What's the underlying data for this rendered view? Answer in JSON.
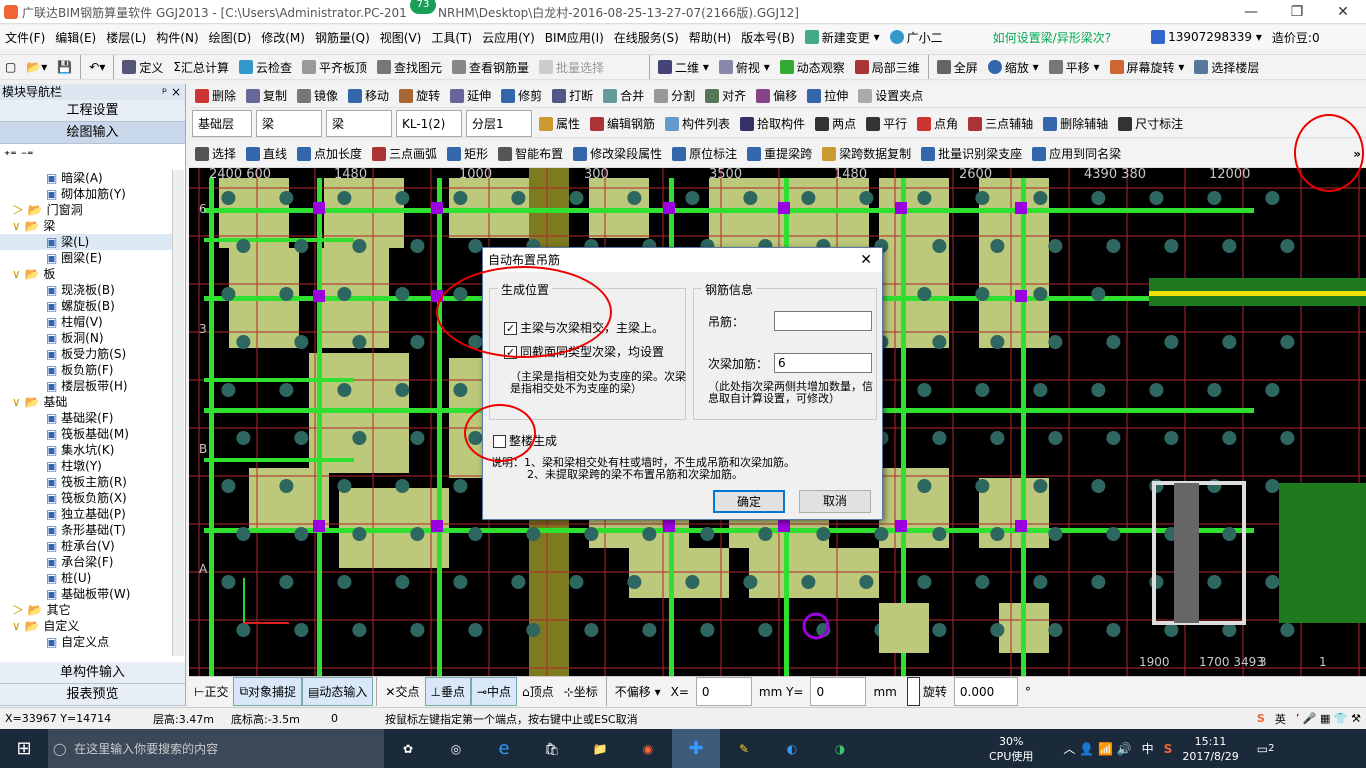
{
  "window": {
    "title": "广联达BIM钢筋算量软件 GGJ2013 - [C:\\Users\\Administrator.PC-201",
    "title_tail": "NRHM\\Desktop\\白龙村-2016-08-25-13-27-07(2166版).GGJ12]",
    "badge": "73"
  },
  "menu": {
    "items": [
      "文件(F)",
      "编辑(E)",
      "楼层(L)",
      "构件(N)",
      "绘图(D)",
      "修改(M)",
      "钢筋量(Q)",
      "视图(V)",
      "工具(T)",
      "云应用(Y)",
      "BIM应用(I)",
      "在线服务(S)",
      "帮助(H)",
      "版本号(B)",
      "新建变更",
      "广小二"
    ],
    "question": "如何设置梁/异形梁次?",
    "phone": "13907298339",
    "cost": "造价豆:0"
  },
  "toolbar1": {
    "items": [
      "定义",
      "汇总计算",
      "云检查",
      "平齐板顶",
      "查找图元",
      "查看钢筋量",
      "批量选择",
      "二维",
      "俯视",
      "动态观察",
      "局部三维",
      "全屏",
      "缩放",
      "平移",
      "屏幕旋转",
      "选择楼层"
    ]
  },
  "toolbar2": {
    "items": [
      "删除",
      "复制",
      "镜像",
      "移动",
      "旋转",
      "延伸",
      "修剪",
      "打断",
      "合并",
      "分割",
      "对齐",
      "偏移",
      "拉伸",
      "设置夹点"
    ]
  },
  "toolbar3": {
    "combos": [
      "基础层",
      "梁",
      "梁",
      "KL-1(2)",
      "分层1"
    ],
    "items": [
      "属性",
      "编辑钢筋",
      "构件列表",
      "拾取构件",
      "两点",
      "平行",
      "点角",
      "三点辅轴",
      "删除辅轴",
      "尺寸标注"
    ]
  },
  "toolbar4": {
    "items": [
      "选择",
      "直线",
      "点加长度",
      "三点画弧",
      "矩形",
      "智能布置",
      "修改梁段属性",
      "原位标注",
      "重提梁跨",
      "梁跨数据复制",
      "批量识别梁支座",
      "应用到同名梁"
    ],
    "more": "»"
  },
  "nav": {
    "title": "模块导航栏",
    "pin": "ᵖ ×",
    "btn_project": "工程设置",
    "btn_draw": "绘图输入",
    "btn_single": "单构件输入",
    "btn_report": "报表预览"
  },
  "tree": [
    {
      "lvl": 2,
      "t": "暗梁(A)"
    },
    {
      "lvl": 2,
      "t": "砌体加筋(Y)"
    },
    {
      "lvl": 1,
      "t": "门窗洞",
      "exp": "＞"
    },
    {
      "lvl": 1,
      "t": "梁",
      "exp": "∨"
    },
    {
      "lvl": 2,
      "t": "梁(L)",
      "sel": true
    },
    {
      "lvl": 2,
      "t": "圈梁(E)"
    },
    {
      "lvl": 1,
      "t": "板",
      "exp": "∨"
    },
    {
      "lvl": 2,
      "t": "现浇板(B)"
    },
    {
      "lvl": 2,
      "t": "螺旋板(B)"
    },
    {
      "lvl": 2,
      "t": "柱帽(V)"
    },
    {
      "lvl": 2,
      "t": "板洞(N)"
    },
    {
      "lvl": 2,
      "t": "板受力筋(S)"
    },
    {
      "lvl": 2,
      "t": "板负筋(F)"
    },
    {
      "lvl": 2,
      "t": "楼层板带(H)"
    },
    {
      "lvl": 1,
      "t": "基础",
      "exp": "∨"
    },
    {
      "lvl": 2,
      "t": "基础梁(F)"
    },
    {
      "lvl": 2,
      "t": "筏板基础(M)"
    },
    {
      "lvl": 2,
      "t": "集水坑(K)"
    },
    {
      "lvl": 2,
      "t": "柱墩(Y)"
    },
    {
      "lvl": 2,
      "t": "筏板主筋(R)"
    },
    {
      "lvl": 2,
      "t": "筏板负筋(X)"
    },
    {
      "lvl": 2,
      "t": "独立基础(P)"
    },
    {
      "lvl": 2,
      "t": "条形基础(T)"
    },
    {
      "lvl": 2,
      "t": "桩承台(V)"
    },
    {
      "lvl": 2,
      "t": "承台梁(F)"
    },
    {
      "lvl": 2,
      "t": "桩(U)"
    },
    {
      "lvl": 2,
      "t": "基础板带(W)"
    },
    {
      "lvl": 1,
      "t": "其它",
      "exp": "＞"
    },
    {
      "lvl": 1,
      "t": "自定义",
      "exp": "∨"
    },
    {
      "lvl": 2,
      "t": "自定义点"
    }
  ],
  "canvas": {
    "dims": [
      "2400 600",
      "1480",
      "1000",
      "300",
      "3500",
      "1480",
      "2600",
      "4390 380",
      "12000"
    ],
    "axes": [
      "6",
      "3",
      "B",
      "A"
    ],
    "bottom_dims": [
      "1900",
      "1700 3493",
      "3",
      "1"
    ]
  },
  "dialog": {
    "title": "自动布置吊筋",
    "close": "✕",
    "gen_title": "生成位置",
    "cb1": "主梁与次梁相交，主梁上。",
    "cb2": "同截面同类型次梁，均设置",
    "note1": "（主梁是指相交处为支座的梁。次梁是指相交处不为支座的梁）",
    "rebar_title": "钢筋信息",
    "hang_label": "吊筋：",
    "hang_value": "",
    "extra_label": "次梁加筋：",
    "extra_value": "6",
    "note2": "（此处指次梁两侧共增加数量，信息取自计算设置，可修改）",
    "whole": "整楼生成",
    "explain1": "说明：1、梁和梁相交处有柱或墙时，不生成吊筋和次梁加筋。",
    "explain2": "2、未提取梁跨的梁不布置吊筋和次梁加筋。",
    "ok": "确定",
    "cancel": "取消"
  },
  "bottom": {
    "items": [
      "正交",
      "对象捕捉",
      "动态输入",
      "交点",
      "垂点",
      "中点",
      "顶点",
      "坐标",
      "不偏移"
    ],
    "x_label": "X=",
    "x": "0",
    "y_label": "mm Y=",
    "y": "0",
    "mm": "mm",
    "rot": "旋转",
    "rot_val": "0.000",
    "deg": "°"
  },
  "status": {
    "coords": "X=33967 Y=14714",
    "floor_h": "层高:3.47m",
    "bottom_h": "底标高:-3.5m",
    "zero": "0",
    "hint": "按鼠标左键指定第一个端点，按右键中止或ESC取消",
    "ime": "英"
  },
  "taskbar": {
    "search": "在这里输入你要搜索的内容",
    "cpu": "30%",
    "cpu_label": "CPU使用",
    "time": "15:11",
    "date": "2017/8/29",
    "lang": "中",
    "notif": "2"
  }
}
